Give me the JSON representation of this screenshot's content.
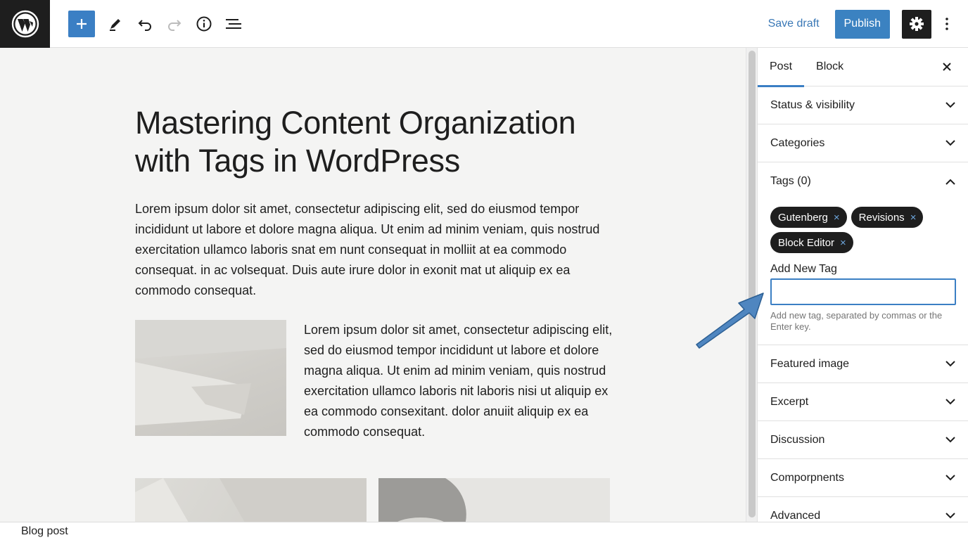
{
  "toolbar": {
    "logo_icon": "wordpress-logo",
    "add_icon": "plus-icon",
    "tools": [
      "pencil-icon",
      "undo-icon",
      "redo-icon",
      "info-icon",
      "list-view-icon"
    ],
    "save_draft_label": "Save draft",
    "publish_label": "Publish",
    "settings_icon": "gear-icon",
    "more_icon": "vertical-ellipsis-icon"
  },
  "post": {
    "title": "Mastering Content Organization with Tags in WordPress",
    "paragraph1": "Lorem ipsum dolor sit amet, consectetur adipiscing elit, sed do eiusmod tempor incididunt ut labore et dolore magna aliqua. Ut enim ad minim veniam, quis nostrud exercitation ullamco laboris snat em nunt consequat in molliit at ea commodo consequat. in ac volsequat. Duis aute irure dolor in exonit mat ut aliquip ex ea commodo consequat.",
    "paragraph2": "Lorem ipsum dolor sit amet, consectetur adipiscing elit, sed do eiusmod tempor incididunt ut labore et dolore magna aliqua. Ut enim ad minim veniam, quis nostrud exercitation ullamco laboris nit laboris nisi ut aliquip ex ea commodo consexitant. dolor anuiit aliquip ex ea commodo consequat."
  },
  "sidebar": {
    "tabs": [
      "Post",
      "Block"
    ],
    "active_tab": "Post",
    "close_icon": "close-icon",
    "panels_top": [
      "Status & visibility",
      "Categories"
    ],
    "tags_panel": {
      "title": "Tags (0)",
      "chips": [
        "Gutenberg",
        "Revisions",
        "Block Editor"
      ],
      "chip_remove": "×",
      "add_label": "Add New Tag",
      "input_value": "",
      "help_text": "Add new tag, separated by commas or the Enter key."
    },
    "panels_bottom": [
      "Featured image",
      "Excerpt",
      "Discussion",
      "Comporpnents",
      "Advanced"
    ]
  },
  "footer": {
    "breadcrumb": "Blog post"
  },
  "colors": {
    "accent": "#3b7fc4",
    "dark": "#1e1e1e",
    "canvas_bg": "#f4f4f3"
  }
}
